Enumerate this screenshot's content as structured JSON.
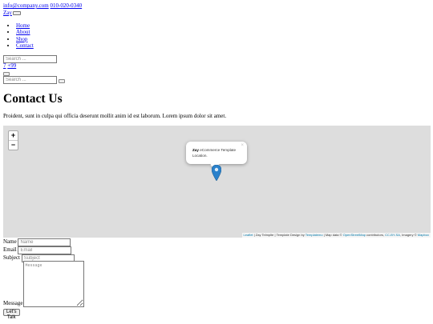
{
  "topbar": {
    "email": "info@company.com",
    "phone": "010-020-0340"
  },
  "brand": {
    "name": "Zay"
  },
  "nav": {
    "items": [
      "Home",
      "About",
      "Shop",
      "Contact"
    ]
  },
  "search": {
    "placeholder": "Search ..."
  },
  "cart": {
    "count_label": "7",
    "user_label": "+99"
  },
  "page": {
    "title": "Contact Us",
    "lead": "Proident, sunt in culpa qui officia deserunt mollit anim id est laborum. Lorem ipsum dolor sit amet."
  },
  "map": {
    "zoom_in": "+",
    "zoom_out": "−",
    "popup_bold": "Zay",
    "popup_text": " eCommerce Template Location.",
    "popup_close": "×",
    "marker_color": "#2a81cb",
    "background": "#dddddd",
    "attribution": {
      "leaflet": "Leaflet",
      "mid1": " | Zay Telmplte | Template Design by ",
      "templatemo": "Templatemo",
      "mid2": " | Map data © ",
      "osm": "OpenStreetMap",
      "mid3": " contributors, ",
      "license": "CC-BY-SA",
      "mid4": ", Imagery © ",
      "mapbox": "Mapbox"
    }
  },
  "form": {
    "name_label": "Name",
    "name_placeholder": "Name",
    "email_label": "Email",
    "email_placeholder": "Email",
    "subject_label": "Subject",
    "subject_placeholder": "Subject",
    "message_label": "Message",
    "message_placeholder": "Message",
    "submit_label": "Let's Talk"
  }
}
